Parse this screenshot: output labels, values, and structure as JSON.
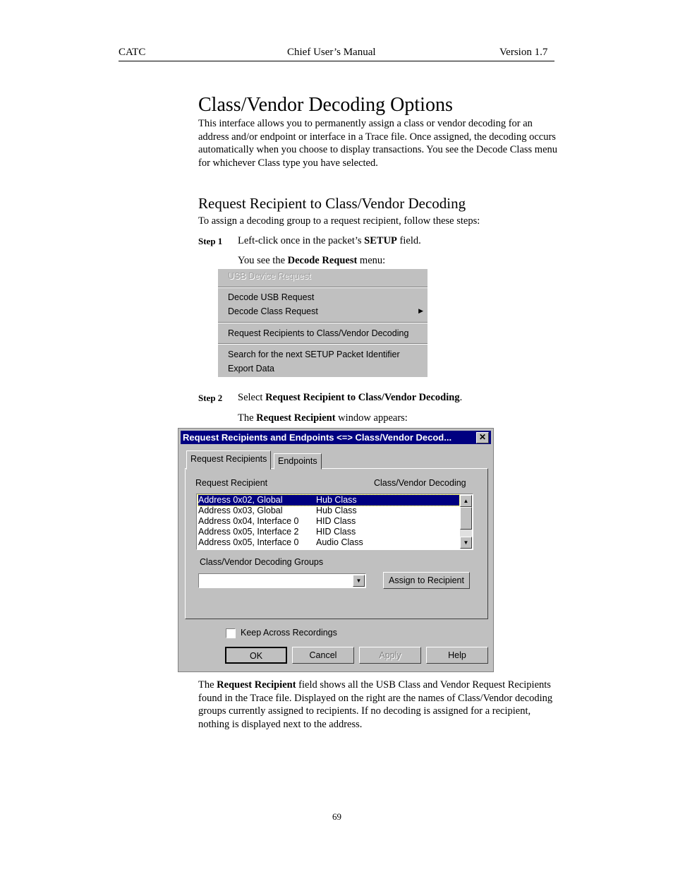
{
  "header": {
    "left": "CATC",
    "center": "Chief User’s Manual",
    "right": "Version 1.7"
  },
  "title": "Class/Vendor Decoding Options",
  "intro": "This interface allows you to permanently assign a class or vendor decoding for an address and/or endpoint or interface in a Trace file. Once assigned, the decoding occurs automatically when you choose to display transactions. You see the Decode Class menu for whichever Class type you have selected.",
  "section_title": "Request Recipient to Class/Vendor Decoding",
  "section_intro": "To assign a decoding group to a request recipient, follow these steps:",
  "step1": {
    "label": "Step 1",
    "pre": "Left-click once in the packet’s ",
    "bold": "SETUP",
    "post": " field.",
    "sub_pre": "You see the ",
    "sub_bold": "Decode Request",
    "sub_post": " menu:"
  },
  "menu": {
    "header": "USB Device Request",
    "items": [
      "Decode USB Request",
      "Decode Class Request",
      "Request Recipients to Class/Vendor Decoding",
      "Search for the next SETUP Packet Identifier",
      "Export Data"
    ]
  },
  "step2": {
    "label": "Step 2",
    "pre": "Select ",
    "bold": "Request Recipient to Class/Vendor Decoding",
    "post": ".",
    "sub_pre": "The ",
    "sub_bold": "Request Recipient",
    "sub_post": " window appears:"
  },
  "dialog": {
    "title": "Request Recipients and Endpoints <=> Class/Vendor Decod...",
    "close": "✕",
    "tabs": [
      "Request Recipients",
      "Endpoints"
    ],
    "col1": "Request Recipient",
    "col2": "Class/Vendor Decoding",
    "rows": [
      {
        "recipient": "Address 0x02, Global",
        "decoding": "Hub Class"
      },
      {
        "recipient": "Address 0x03, Global",
        "decoding": "Hub Class"
      },
      {
        "recipient": "Address 0x04, Interface 0",
        "decoding": "HID Class"
      },
      {
        "recipient": "Address 0x05, Interface 2",
        "decoding": "HID Class"
      },
      {
        "recipient": "Address 0x05, Interface 0",
        "decoding": "Audio Class"
      }
    ],
    "groups_label": "Class/Vendor Decoding Groups",
    "groups_value": "",
    "assign": "Assign to Recipient",
    "keep": "Keep Across Recordings",
    "keep_checked": false,
    "ok": "OK",
    "cancel": "Cancel",
    "apply": "Apply",
    "help": "Help"
  },
  "outro_pre": "The ",
  "outro_bold": "Request Recipient",
  "outro_post": " field shows all the USB Class and Vendor Request Recipients found in the Trace file. Displayed on the right are the names of Class/Vendor decoding groups currently assigned to recipients. If no decoding is assigned for a recipient, nothing is displayed next to the address.",
  "page_number": "69"
}
